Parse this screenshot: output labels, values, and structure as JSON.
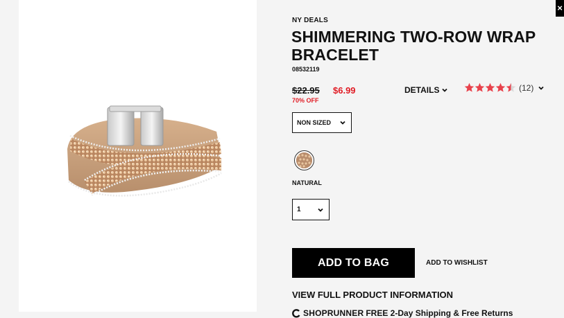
{
  "product": {
    "brand": "NY DEALS",
    "title": "SHIMMERING TWO-ROW WRAP BRACELET",
    "sku": "08532119",
    "original_price": "$22.95",
    "sale_price": "$6.99",
    "discount": "70% OFF"
  },
  "details": {
    "label": "DETAILS"
  },
  "rating": {
    "stars": 4.5,
    "count": "(12)"
  },
  "size": {
    "selected": "NON SIZED"
  },
  "color": {
    "label": "NATURAL",
    "swatch_color": "#b98d6c"
  },
  "quantity": {
    "selected": "1"
  },
  "actions": {
    "add_to_bag": "ADD TO BAG",
    "add_to_wishlist": "ADD TO WISHLIST",
    "view_full": "VIEW FULL PRODUCT INFORMATION"
  },
  "shoprunner": {
    "logo": "SHOPRUNNER",
    "text": "FREE 2-Day Shipping & Free Returns"
  },
  "colors": {
    "sale_red": "#e01b24",
    "star_red": "#e8414b",
    "button_black": "#000000"
  },
  "icons": {
    "close": "close-icon",
    "chevron": "chevron-down-icon",
    "star": "star-icon",
    "shoprunner": "shoprunner-logo-icon"
  }
}
